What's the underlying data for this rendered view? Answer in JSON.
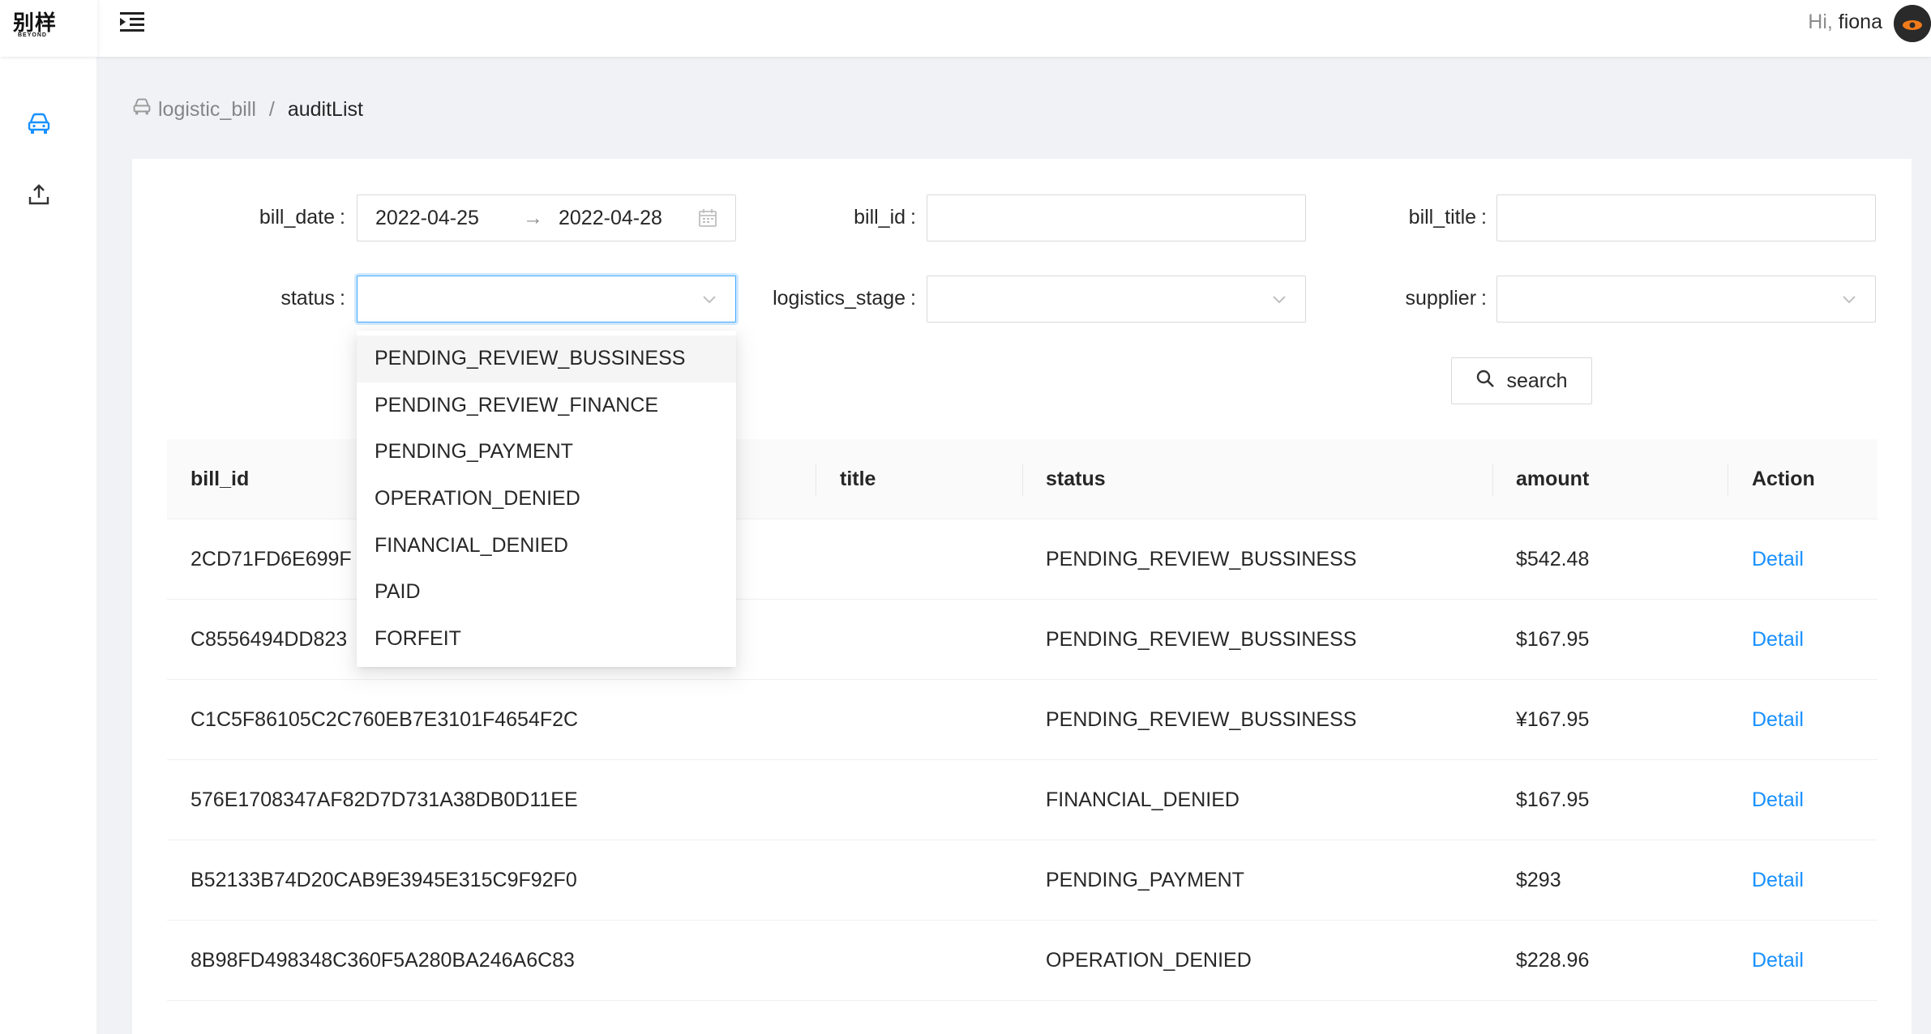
{
  "header": {
    "logo_cn": "别样",
    "logo_en": "BEYOND",
    "greeting_hi": "Hi,",
    "user_name": "fiona"
  },
  "breadcrumb": {
    "root": "logistic_bill",
    "separator": "/",
    "current": "auditList"
  },
  "filters": {
    "bill_date_label": "bill_date",
    "bill_date_start": "2022-04-25",
    "bill_date_arrow": "→",
    "bill_date_end": "2022-04-28",
    "bill_id_label": "bill_id",
    "bill_id_value": "",
    "bill_title_label": "bill_title",
    "bill_title_value": "",
    "status_label": "status",
    "status_value": "",
    "logistics_stage_label": "logistics_stage",
    "logistics_stage_value": "",
    "supplier_label": "supplier",
    "supplier_value": "",
    "colon": ":",
    "search_label": "search"
  },
  "status_dropdown": {
    "options": [
      "PENDING_REVIEW_BUSSINESS",
      "PENDING_REVIEW_FINANCE",
      "PENDING_PAYMENT",
      "OPERATION_DENIED",
      "FINANCIAL_DENIED",
      "PAID",
      "FORFEIT"
    ],
    "highlighted": "PENDING_REVIEW_BUSSINESS"
  },
  "table": {
    "columns": [
      "bill_id",
      "title",
      "status",
      "amount",
      "Action"
    ],
    "rows": [
      {
        "bill_id": "2CD71FD6E699F",
        "title": "",
        "status": "PENDING_REVIEW_BUSSINESS",
        "amount": "$542.48",
        "action": "Detail"
      },
      {
        "bill_id": "C8556494DD823",
        "title": "",
        "status": "PENDING_REVIEW_BUSSINESS",
        "amount": "$167.95",
        "action": "Detail"
      },
      {
        "bill_id": "C1C5F86105C2C760EB7E3101F4654F2C",
        "title": "",
        "status": "PENDING_REVIEW_BUSSINESS",
        "amount": "¥167.95",
        "action": "Detail"
      },
      {
        "bill_id": "576E1708347AF82D7D731A38DB0D11EE",
        "title": "",
        "status": "FINANCIAL_DENIED",
        "amount": "$167.95",
        "action": "Detail"
      },
      {
        "bill_id": "B52133B74D20CAB9E3945E315C9F92F0",
        "title": "",
        "status": "PENDING_PAYMENT",
        "amount": "$293",
        "action": "Detail"
      },
      {
        "bill_id": "8B98FD498348C360F5A280BA246A6C83",
        "title": "",
        "status": "OPERATION_DENIED",
        "amount": "$228.96",
        "action": "Detail"
      }
    ]
  },
  "colors": {
    "primary": "#1890ff",
    "focus_border": "#40a9ff",
    "page_bg": "#f0f2f5"
  },
  "icons": {
    "menu_toggle": "menu-unfold-icon",
    "sidebar_1": "car-icon",
    "sidebar_2": "upload-icon",
    "calendar": "calendar-icon",
    "select_arrow": "chevron-down-icon",
    "search": "search-icon"
  }
}
